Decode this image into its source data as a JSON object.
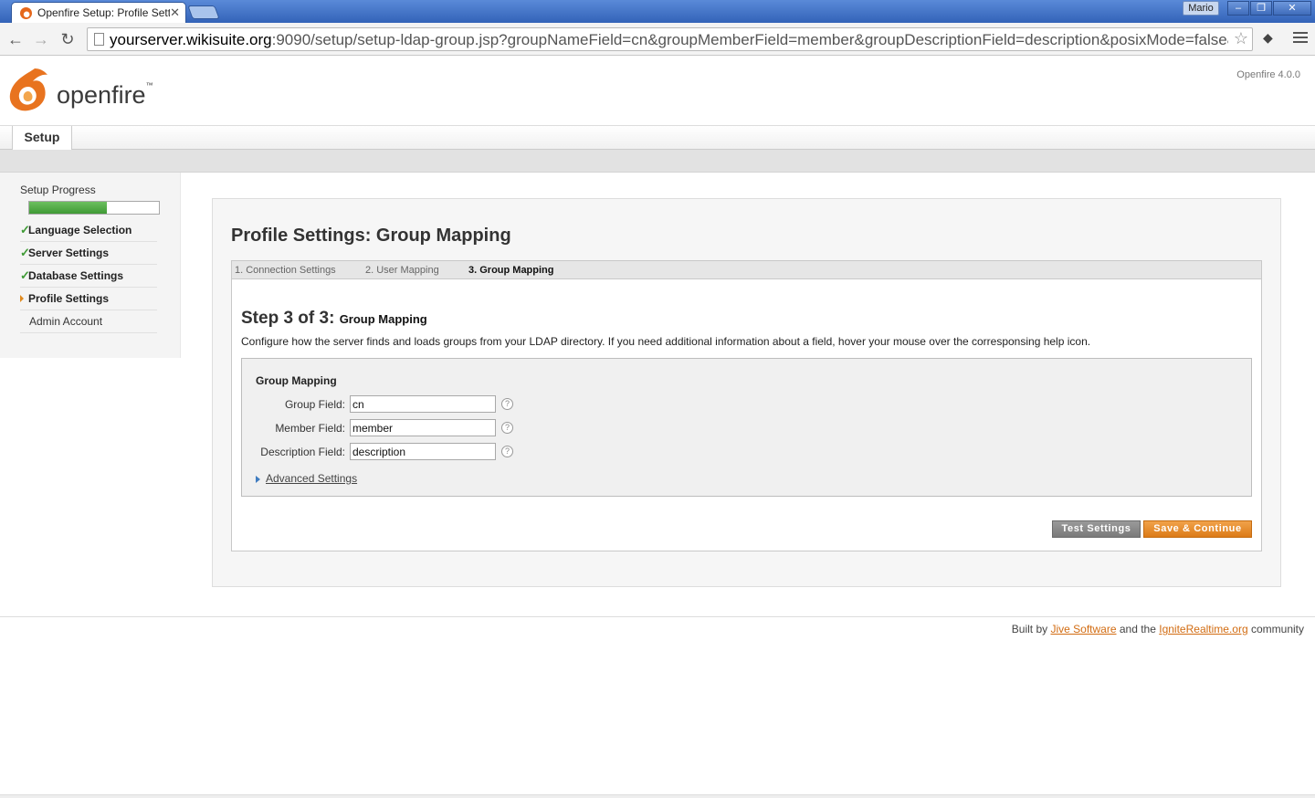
{
  "browser": {
    "tab_title": "Openfire Setup: Profile Settir",
    "user_label": "Mario",
    "url_host": "yourserver.wikisuite.org",
    "url_rest": ":9090/setup/setup-ldap-group.jsp?groupNameField=cn&groupMemberField=member&groupDescriptionField=description&posixMode=false&groupSe"
  },
  "header": {
    "brand": "openfire",
    "version": "Openfire 4.0.0",
    "nav_tab": "Setup"
  },
  "sidebar": {
    "progress_label": "Setup Progress",
    "progress_fraction": 0.6,
    "items": [
      {
        "label": "Language Selection",
        "state": "done"
      },
      {
        "label": "Server Settings",
        "state": "done"
      },
      {
        "label": "Database Settings",
        "state": "done"
      },
      {
        "label": "Profile Settings",
        "state": "active"
      },
      {
        "label": "Admin Account",
        "state": "todo"
      }
    ]
  },
  "main": {
    "title": "Profile Settings: Group Mapping",
    "steps": [
      "1. Connection Settings",
      "2. User Mapping",
      "3. Group Mapping"
    ],
    "step_heading": "Step 3 of 3:",
    "step_subheading": "Group Mapping",
    "description": "Configure how the server finds and loads groups from your LDAP directory. If you need additional information about a field, hover your mouse over the corresponsing help icon.",
    "box_title": "Group Mapping",
    "fields": [
      {
        "label": "Group Field:",
        "value": "cn"
      },
      {
        "label": "Member Field:",
        "value": "member"
      },
      {
        "label": "Description Field:",
        "value": "description"
      }
    ],
    "help_glyph": "?",
    "advanced_label": "Advanced Settings",
    "test_button": "Test Settings",
    "save_button": "Save & Continue"
  },
  "footer": {
    "text_1": "Built by",
    "link_1": "Jive Software",
    "text_2": "and the",
    "link_2": "IgniteRealtime.org",
    "text_3": "community"
  },
  "colors": {
    "accent": "#dc7b18",
    "progress": "#3f9a35",
    "titlebar": "#3363b8"
  }
}
